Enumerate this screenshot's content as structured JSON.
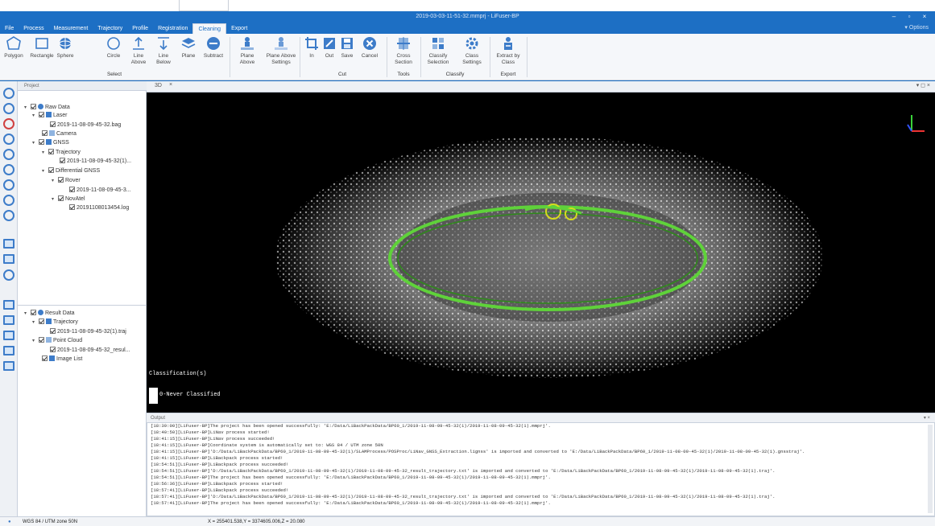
{
  "window": {
    "title": "2019-03-03-11-51-32.mmprj - LiFuser-BP"
  },
  "menu": {
    "items": [
      "File",
      "Process",
      "Measurement",
      "Trajectory",
      "Profile",
      "Registration",
      "Cleaning",
      "Export"
    ],
    "active": "Cleaning",
    "options": "Options"
  },
  "ribbon": {
    "select": {
      "label": "Select",
      "tools": [
        "Polygon",
        "Rectangle",
        "Sphere",
        "Circle",
        "Line Above",
        "Line Below",
        "Plane",
        "Subtract"
      ]
    },
    "plane": {
      "tools": [
        "Plane Above",
        "Plane Above Settings"
      ]
    },
    "cut": {
      "label": "Cut",
      "tools": [
        "In",
        "Out",
        "Save",
        "Cancel"
      ]
    },
    "tools": {
      "label": "Tools",
      "tools": [
        "Cross Section"
      ]
    },
    "classify": {
      "label": "Classify",
      "tools": [
        "Classify Selection",
        "Class Settings"
      ]
    },
    "export": {
      "label": "Export",
      "tools": [
        "Extract by Class"
      ]
    }
  },
  "project_panel": {
    "title": "Project",
    "raw": "Raw Data",
    "laser": "Laser",
    "laser_file": "2019-11-08-09-45-32.bag",
    "camera": "Camera",
    "gnss": "GNSS",
    "trajectory": "Trajectory",
    "trajectory_file": "2019-11-08-09-45-32(1)...",
    "diff_gnss": "Differential GNSS",
    "rover": "Rover",
    "rover_file": "2019-11-08-09-45-3...",
    "novatel": "NovAtel",
    "novatel_file": "20191108013454.log",
    "result": "Result Data",
    "res_trajectory": "Trajectory",
    "res_trajectory_file": "2019-11-08-09-45-32(1).traj",
    "point_cloud": "Point Cloud",
    "point_cloud_file": "2019-11-08-09-45-32_resul...",
    "image_list": "Image List"
  },
  "view": {
    "tab": "3D",
    "classification_title": "Classification(s)",
    "class_label": "0-Never Classified"
  },
  "output": {
    "title": "Output",
    "lines": [
      "[18:39:00][LiFuser-BP]The project has been opened successfully: 'E:/Data/LiBackPackData/BP60_1/2019-11-08-09-45-32(1)/2019-11-08-09-45-32(1).mmprj'.",
      "[18:40:50][LiFuser-BP]LiNav process started!",
      "[18:41:15][LiFuser-BP]LiNav process succeeded!",
      "[18:41:15][LiFuser-BP]Coordinate system is automatically set to: WGS 84 / UTM zone 50N",
      "[18:41:15][LiFuser-BP]'D:/Data/LiBackPackData/BP60_1/2019-11-08-09-45-32(1)/SLAMProcess/POSProc/LiNav_GNSS_Extraction.lignss' is imported and converted to 'E:/Data/LiBackPackData/BP60_1/2019-11-08-09-45-32(1)/2019-11-08-09-45-32(1).gnsstraj'.",
      "[18:41:15][LiFuser-BP]LiBackpack process started!",
      "[18:54:51][LiFuser-BP]LiBackpack process succeeded!",
      "[18:54:51][LiFuser-BP]'D:/Data/LiBackPackData/BP60_1/2019-11-08-09-45-32(1)/2019-11-08-09-45-32_result_trajectory.txt' is imported and converted to 'E:/Data/LiBackPackData/BP60_1/2019-11-08-09-45-32(1)/2019-11-08-09-45-32(1).traj'.",
      "[18:54:51][LiFuser-BP]The project has been opened successfully: 'E:/Data/LiBackPackData/BP60_1/2019-11-08-09-45-32(1)/2019-11-08-09-45-32(1).mmprj'.",
      "[18:56:36][LiFuser-BP]LiBackpack process started!",
      "[18:57:41][LiFuser-BP]LiBackpack process succeeded!",
      "[18:57:41][LiFuser-BP]'D:/Data/LiBackPackData/BP60_1/2019-11-08-09-45-32(1)/2019-11-08-09-45-32_result_trajectory.txt' is imported and converted to 'E:/Data/LiBackPackData/BP60_1/2019-11-08-09-45-32(1)/2019-11-08-09-45-32(1).traj'.",
      "[18:57:41][LiFuser-BP]The project has been opened successfully: 'E:/Data/LiBackPackData/BP60_1/2019-11-08-09-45-32(1)/2019-11-08-09-45-32(1).mmprj'."
    ]
  },
  "status": {
    "crs": "WGS 84 / UTM zone 50N",
    "coords": "X = 255401.538,Y = 3374605.006,Z = 20.080"
  },
  "colors": {
    "accent": "#1d6fc4",
    "trajectory": "#5fd23a",
    "highlight": "#d6dc1e"
  }
}
